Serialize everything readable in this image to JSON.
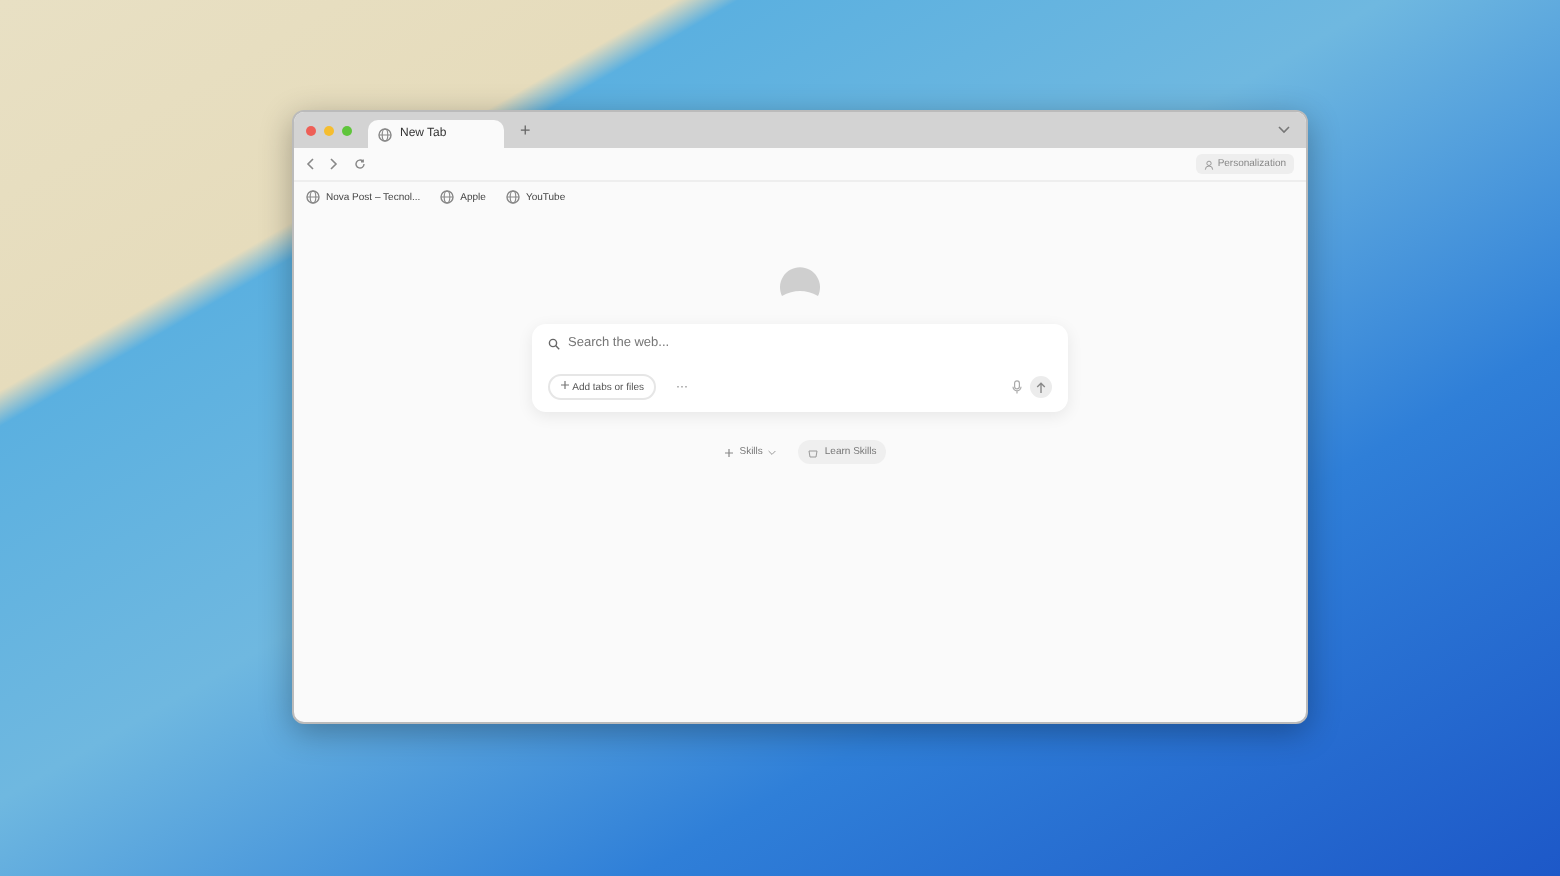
{
  "window": {
    "tabs": [
      {
        "label": "New Tab",
        "selected": true
      }
    ],
    "new_tab_button": "+"
  },
  "toolbar": {
    "personalization_button": "Personalization"
  },
  "bookmarks": [
    {
      "label": "Nova Post – Tecnol..."
    },
    {
      "label": "Apple"
    },
    {
      "label": "YouTube"
    }
  ],
  "search": {
    "placeholder": "Search the web...",
    "add_button": "Add tabs or files",
    "more_button": "···"
  },
  "skills": {
    "skills_button": "Skills",
    "learn_button": "Learn Skills"
  }
}
